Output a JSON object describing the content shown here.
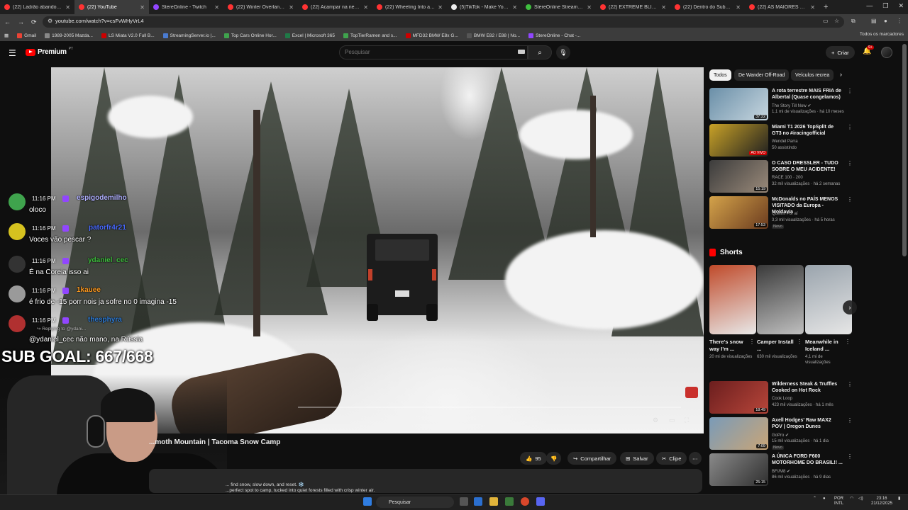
{
  "browser": {
    "tabs": [
      {
        "title": "(22) Ladrão abandona mu",
        "color": "#ff3333"
      },
      {
        "title": "(22) YouTube",
        "color": "#ff3333",
        "active": true
      },
      {
        "title": "StereOnline - Twitch",
        "color": "#9146ff"
      },
      {
        "title": "(22) Winter Overlanding I",
        "color": "#ff3333"
      },
      {
        "title": "(22) Acampar na neve for",
        "color": "#ff3333"
      },
      {
        "title": "(22) Wheeling Into a Swe",
        "color": "#ff3333"
      },
      {
        "title": "(5)TikTok - Make Your Day",
        "color": "#eeeeee"
      },
      {
        "title": "StereOnline Stream - Wat",
        "color": "#3fbf3f"
      },
      {
        "title": "(22) EXTREME BLIZZARD",
        "color": "#ff3333"
      },
      {
        "title": "(22) Dentro do Submundo",
        "color": "#ff3333"
      },
      {
        "title": "(22) AS MAIORES QUEDA",
        "color": "#ff3333"
      }
    ],
    "url": "youtube.com/watch?v=csFvWHyVrL4",
    "bookmarks": [
      {
        "label": "Gmail",
        "color": "#ea4335"
      },
      {
        "label": "1989-2005 Mazda...",
        "color": "#888888"
      },
      {
        "label": "LS Miata V2.0 Full B...",
        "color": "#cc0000"
      },
      {
        "label": "StreamingServer.io |...",
        "color": "#4a7bd0"
      },
      {
        "label": "Top Cars Online Hor...",
        "color": "#3fa34d"
      },
      {
        "label": "Excel | Microsoft 365",
        "color": "#1f7a47"
      },
      {
        "label": "TopTierRamen and s...",
        "color": "#3fa34d"
      },
      {
        "label": "MFD32 BMW E8x G...",
        "color": "#cc0000"
      },
      {
        "label": "BMW E82 / E88 | No...",
        "color": "#555555"
      },
      {
        "label": "StereOnline - Chat -...",
        "color": "#9146ff"
      }
    ],
    "all_bookmarks": "Todos os marcadores"
  },
  "youtube": {
    "logo": "Premium",
    "logo_country": "PT",
    "search_placeholder": "Pesquisar",
    "create_label": "Criar",
    "notif_count": "9+",
    "video_title": "...moth Mountain | Tacoma Snow Camp",
    "actions": {
      "likes": "95",
      "share": "Compartilhar",
      "save": "Salvar",
      "clip": "Clipe"
    },
    "description_lines": [
      "... find snow, slow down, and reset. ❄️",
      "...perfect spot to camp, tucked into quiet forests filled with crisp winter air."
    ],
    "chips": [
      "Todos",
      "De Wander Off-Road",
      "Veículos recrea"
    ],
    "recommendations": [
      {
        "title": "A rota terrestre MAIS FRIA de Albertal (Quase congelamos)",
        "channel": "The Story Till Now ✔",
        "meta": "1,1 mi de visualizações · há 10 meses",
        "duration": "37:22",
        "c1": "#6a8fa8",
        "c2": "#c7d6df"
      },
      {
        "title": "Miami T1 2026 TopSplit de GT3 no #iracingofficial",
        "channel": "Wendel Parra",
        "meta": "50 assistindo",
        "duration": "AO VIVO",
        "live": true,
        "c1": "#c9a227",
        "c2": "#202020"
      },
      {
        "title": "O CASO DRESSLER - TUDO SOBRE O MEU ACIDENTE!",
        "channel": "RACE 100 · 200",
        "meta": "32 mil visualizações · há 2 semanas",
        "duration": "15:19",
        "c1": "#3c3c3c",
        "c2": "#9a8a7a"
      },
      {
        "title": "McDonalds no PAÍS MENOS VISITADO da Europa - Moldavia",
        "channel": "Queimi Por aí",
        "meta": "3,3 mil visualizações · há 5 horas",
        "duration": "17:53",
        "badge": "Novo",
        "c1": "#d4a34a",
        "c2": "#6b3b1f"
      },
      {
        "title": "Wilderness Steak & Truffles Cooked on Hot Rock",
        "channel": "Cook Loop",
        "meta": "423 mil visualizações · há 1 mês",
        "duration": "18:49",
        "c1": "#6b1e1e",
        "c2": "#b8463a"
      },
      {
        "title": "Axell Hodges' Raw MAX2 POV | Oregon Dunes",
        "channel": "GoPro ✔",
        "meta": "15 mil visualizações · há 1 dia",
        "duration": "7:09",
        "badge": "Novo",
        "c1": "#7a9bb8",
        "c2": "#c9a577"
      },
      {
        "title": "A ÚNICA FORD F600 MOTORHOME DO BRASIL!! ...",
        "channel": "BF//M8 ✔",
        "meta": "86 mil visualizações · há 9 dias",
        "duration": "25:15",
        "c1": "#8a8a8a",
        "c2": "#2f2f2f"
      }
    ],
    "shorts_label": "Shorts",
    "shorts": [
      {
        "title": "There's snow way I'm ...",
        "views": "20 mi de visualizações",
        "c1": "#c04a2a",
        "c2": "#e8e8e8"
      },
      {
        "title": "Camper Install ...",
        "views": "630 mil visualizações",
        "c1": "#3a3a3a",
        "c2": "#bfbfbf"
      },
      {
        "title": "Meanwhile in Iceland ...",
        "views": "4,1 mi de visualizações",
        "c1": "#9aa4ad",
        "c2": "#e6e6e6"
      }
    ]
  },
  "stream_overlay": {
    "chat": [
      {
        "time": "11:16 PM",
        "user": "espigodemilho",
        "user_color": "#b0b0ff",
        "msg": "oloco",
        "avatar": "#3fa34d"
      },
      {
        "time": "11:16 PM",
        "user": "patorfr4r21",
        "user_color": "#4a6bff",
        "msg": "Voces vão pescar ?",
        "avatar": "#d6c21f"
      },
      {
        "time": "11:16 PM",
        "user": "ydaniel_cec",
        "user_color": "#3fbf3f",
        "msg": "É na Coreia isso ai",
        "avatar": "#333333"
      },
      {
        "time": "11:16 PM",
        "user": "1kauee",
        "user_color": "#ff9a1f",
        "msg": "é frio de -15 porr nois ja sofre no 0 imagina -15",
        "avatar": "#9a9a9a"
      },
      {
        "time": "11:16 PM",
        "user": "thesphyra",
        "user_color": "#2d7bd6",
        "msg": "@ydaniel_cec não mano, na Rússia",
        "reply": "↪ Replying to @ydani...",
        "avatar": "#b03030"
      }
    ],
    "sub_goal": "SUB GOAL: 667/668"
  },
  "taskbar": {
    "search_label": "Pesquisar",
    "lang": "POR",
    "layout": "INTL",
    "time": "23:16",
    "date": "21/12/2025"
  }
}
